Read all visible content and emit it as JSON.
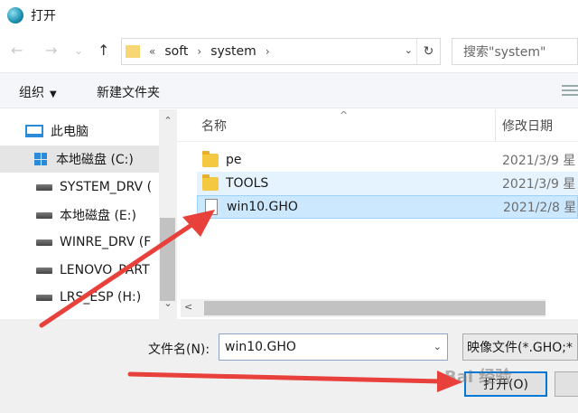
{
  "window": {
    "title": "打开"
  },
  "nav": {
    "back": "←",
    "forward": "→",
    "up": "↑",
    "recent": "⌄"
  },
  "address": {
    "crumbs": [
      "«",
      "soft",
      "›",
      "system",
      "›"
    ],
    "dropdown": "⌄",
    "refresh": "↻"
  },
  "search": {
    "placeholder": "搜索\"system\""
  },
  "toolbar": {
    "organize": "组织",
    "organize_caret": "▼",
    "new_folder": "新建文件夹"
  },
  "sidebar": {
    "items": [
      {
        "label": "此电脑",
        "icon": "pc-icon"
      },
      {
        "label": "本地磁盘 (C:)",
        "icon": "windows-drive-icon"
      },
      {
        "label": "SYSTEM_DRV (",
        "icon": "drive-icon"
      },
      {
        "label": "本地磁盘 (E:)",
        "icon": "drive-icon"
      },
      {
        "label": "WINRE_DRV (F",
        "icon": "drive-icon"
      },
      {
        "label": "LENOVO_PART",
        "icon": "drive-icon"
      },
      {
        "label": "LRS_ESP (H:)",
        "icon": "drive-icon"
      }
    ],
    "scroll_up": "⌃",
    "scroll_down": "⌄"
  },
  "columns": {
    "name": "名称",
    "sort": "^",
    "date": "修改日期"
  },
  "files": [
    {
      "name": "pe",
      "date": "2021/3/9 星",
      "type": "folder"
    },
    {
      "name": "TOOLS",
      "date": "2021/3/9 星",
      "type": "folder"
    },
    {
      "name": "win10.GHO",
      "date": "2021/2/8 星",
      "type": "file"
    }
  ],
  "hscroll": {
    "left": "<"
  },
  "footer": {
    "filename_label": "文件名(N):",
    "filename_value": "win10.GHO",
    "filename_dropdown": "⌄",
    "filetype": "映像文件(*.GHO;*",
    "open": "打开(O)"
  },
  "watermark": "Bai 经验",
  "colors": {
    "accent": "#0078d7",
    "selection": "#cce8ff",
    "hover": "#e5f3ff",
    "folder": "#f5c842",
    "arrow": "#e8403a"
  }
}
